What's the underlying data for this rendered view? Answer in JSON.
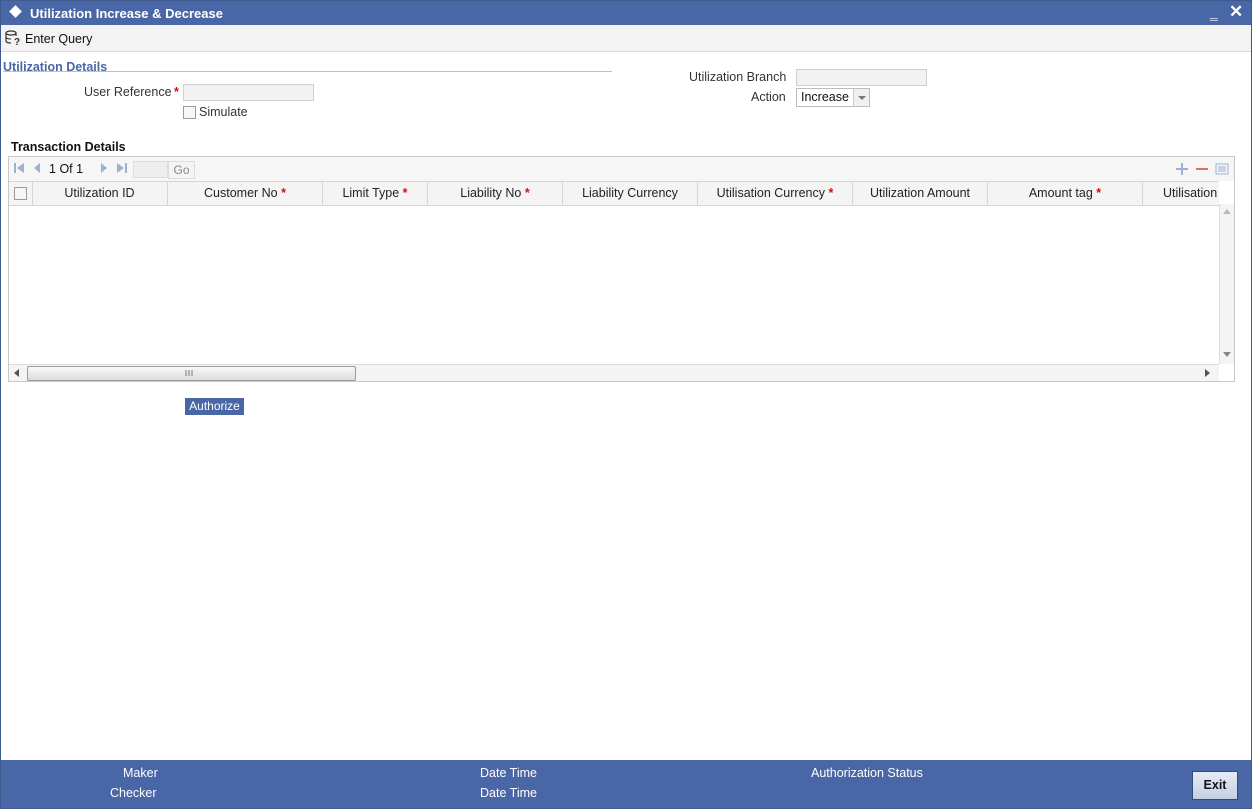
{
  "window": {
    "title": "Utilization Increase & Decrease",
    "minimize_glyph": "‗",
    "close_glyph": "✕"
  },
  "toolbar": {
    "enter_query_label": "Enter Query"
  },
  "utilization_details": {
    "section_title": "Utilization Details",
    "user_reference_label": "User Reference",
    "user_reference_value": "",
    "required_mark": "*",
    "simulate_label": "Simulate",
    "simulate_checked": false,
    "utilization_branch_label": "Utilization Branch",
    "utilization_branch_value": "",
    "action_label": "Action",
    "action_value": "Increase"
  },
  "transaction_details": {
    "section_title": "Transaction Details",
    "pagination": {
      "current": "1",
      "of_label": "Of",
      "total": "1",
      "go_label": "Go"
    },
    "columns": [
      {
        "label": "Utilization ID",
        "required": false
      },
      {
        "label": "Customer No",
        "required": true
      },
      {
        "label": "Limit Type",
        "required": true
      },
      {
        "label": "Liability No",
        "required": true
      },
      {
        "label": "Liability Currency",
        "required": false
      },
      {
        "label": "Utilisation Currency",
        "required": true
      },
      {
        "label": "Utilization Amount",
        "required": false
      },
      {
        "label": "Amount tag",
        "required": true
      },
      {
        "label": "Utilisation",
        "required": false
      }
    ],
    "rows": []
  },
  "authorize_button_label": "Authorize",
  "footer": {
    "maker_label": "Maker",
    "checker_label": "Checker",
    "date_time_label_1": "Date Time",
    "date_time_label_2": "Date Time",
    "authorization_status_label": "Authorization Status",
    "exit_label": "Exit"
  },
  "colors": {
    "brand_blue": "#4966a6",
    "required_red": "#d01010"
  }
}
